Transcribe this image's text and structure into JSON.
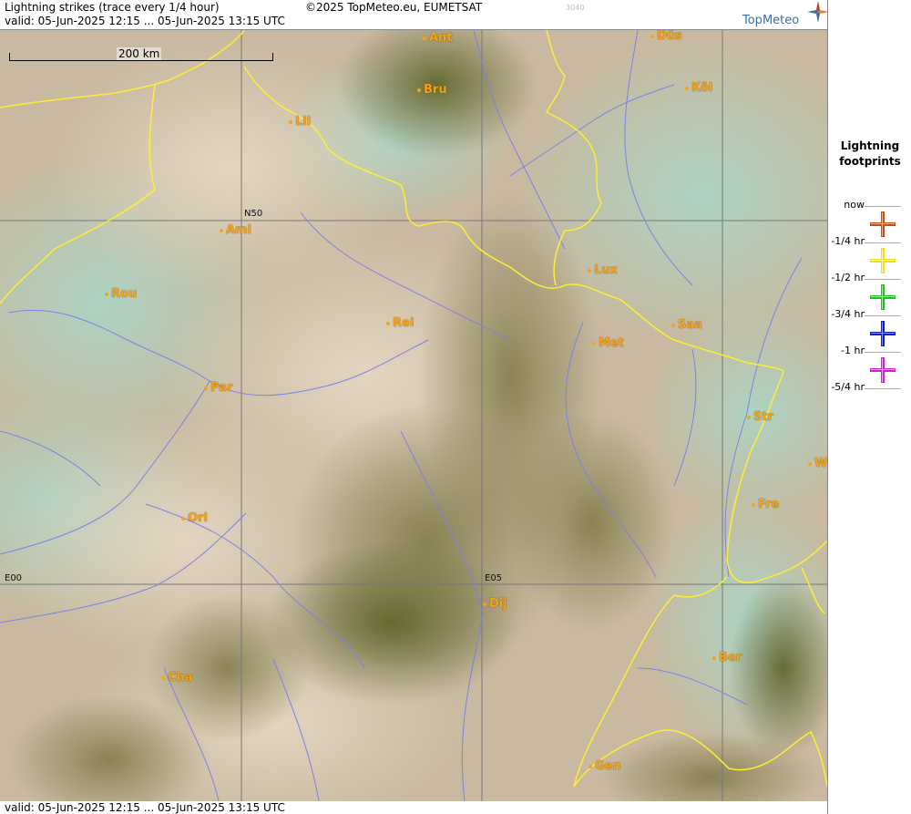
{
  "header": {
    "title": "Lightning strikes (trace every 1/4 hour)",
    "copyright": "©2025 TopMeteo.eu, EUMETSAT",
    "code": "3040",
    "valid": "valid:  05-Jun-2025 12:15 ... 05-Jun-2025 13:15 UTC",
    "brand": "TopMeteo"
  },
  "scale": {
    "label": "200 km"
  },
  "grid_labels": {
    "n50": "N50",
    "e00": "E00",
    "e05": "E05"
  },
  "cities": [
    {
      "name": "Ant"
    },
    {
      "name": "Düs"
    },
    {
      "name": "Bru"
    },
    {
      "name": "Köl"
    },
    {
      "name": "Lil"
    },
    {
      "name": "Ami"
    },
    {
      "name": "Rou"
    },
    {
      "name": "Lux"
    },
    {
      "name": "Rei"
    },
    {
      "name": "Saa"
    },
    {
      "name": "Met"
    },
    {
      "name": "Par"
    },
    {
      "name": "Str"
    },
    {
      "name": "W"
    },
    {
      "name": "Fre"
    },
    {
      "name": "Orl"
    },
    {
      "name": "Dij"
    },
    {
      "name": "Ber"
    },
    {
      "name": "Cha"
    },
    {
      "name": "Gen"
    }
  ],
  "footer": {
    "valid": "valid:  05-Jun-2025 12:15 ... 05-Jun-2025 13:15 UTC"
  },
  "legend": {
    "title_line1": "Lightning",
    "title_line2": "footprints",
    "items": [
      {
        "label": "now",
        "color": "#c0501a"
      },
      {
        "label": "-1/4 hr",
        "color": "#e8e020"
      },
      {
        "label": "-1/2 hr",
        "color": "#20c020"
      },
      {
        "label": "-3/4 hr",
        "color": "#1020c0"
      },
      {
        "label": "-1 hr",
        "color": "#d020d0"
      },
      {
        "label": "-5/4 hr",
        "color": ""
      }
    ]
  },
  "colors": {
    "border": "#ffee33",
    "river": "#7b82e6",
    "city": "#f5a31a",
    "grid": "#777777"
  }
}
